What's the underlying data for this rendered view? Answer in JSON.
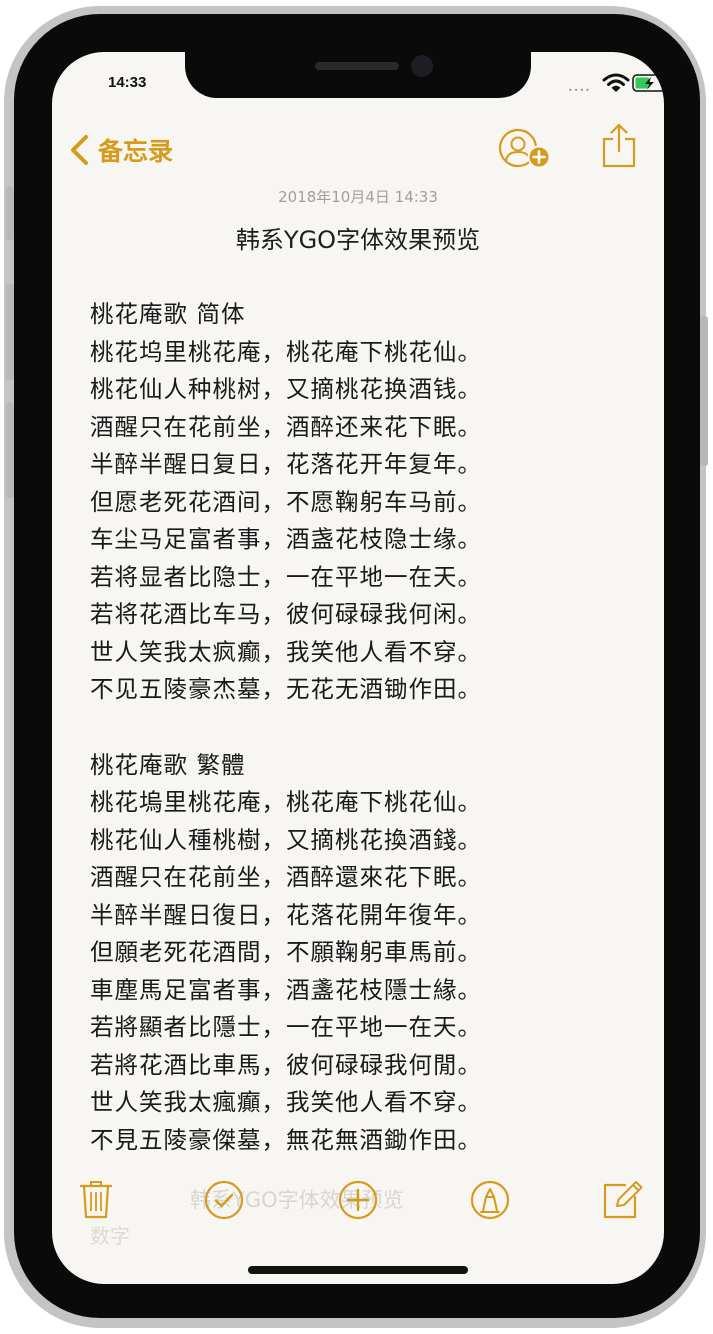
{
  "status_bar": {
    "time": "14:33",
    "signal": "••••",
    "wifi_icon": "wifi-icon",
    "battery_icon": "battery-charging-icon"
  },
  "nav": {
    "back_label": "备忘录",
    "back_icon": "chevron-left-icon",
    "people_icon": "add-people-icon",
    "share_icon": "share-icon"
  },
  "note": {
    "date": "2018年10月4日 14:33",
    "title": "韩系YGO字体效果预览",
    "sections": [
      {
        "heading": "桃花庵歌  简体",
        "lines": [
          "桃花坞里桃花庵，桃花庵下桃花仙。",
          "桃花仙人种桃树，又摘桃花换酒钱。",
          "酒醒只在花前坐，酒醉还来花下眠。",
          "半醉半醒日复日，花落花开年复年。",
          "但愿老死花酒间，不愿鞠躬车马前。",
          "车尘马足富者事，酒盏花枝隐士缘。",
          "若将显者比隐士，一在平地一在天。",
          "若将花酒比车马，彼何碌碌我何闲。",
          "世人笑我太疯癫，我笑他人看不穿。",
          "不见五陵豪杰墓，无花无酒锄作田。"
        ]
      },
      {
        "heading": "桃花庵歌  繁體",
        "lines": [
          "桃花塢里桃花庵，桃花庵下桃花仙。",
          "桃花仙人種桃樹，又摘桃花換酒錢。",
          "酒醒只在花前坐，酒醉還來花下眠。",
          "半醉半醒日復日，花落花開年復年。",
          "但願老死花酒間，不願鞠躬車馬前。",
          "車塵馬足富者事，酒盞花枝隱士緣。",
          "若將顯者比隱士，一在平地一在天。",
          "若將花酒比車馬，彼何碌碌我何閒。",
          "世人笑我太瘋癲，我笑他人看不穿。",
          "不見五陵豪傑墓，無花無酒鋤作田。"
        ]
      }
    ]
  },
  "toolbar": {
    "ghost_text": "韩系YGO字体效果预览",
    "ghost_text2": "数字",
    "delete_icon": "trash-icon",
    "checklist_icon": "checklist-icon",
    "add_icon": "plus-circle-icon",
    "markup_icon": "pen-markup-icon",
    "compose_icon": "compose-icon"
  },
  "colors": {
    "accent": "#d69a1c",
    "paper": "#f7f6f3",
    "text": "#1a1a1a",
    "date": "#a2a09c"
  }
}
